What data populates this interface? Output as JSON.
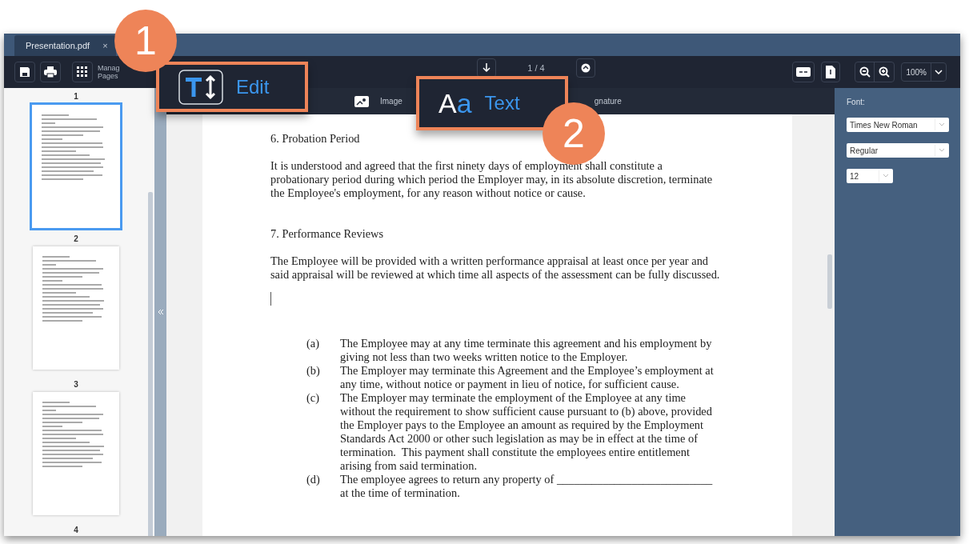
{
  "tab": {
    "title": "Presentation.pdf",
    "close": "×"
  },
  "toolbar": {
    "manage_pages": [
      "Manag",
      "Pages"
    ],
    "page_indicator": "1 / 4",
    "zoom": "100%"
  },
  "edit_toolbar": [
    {
      "kind": "image",
      "label": "Image"
    },
    {
      "kind": "signature",
      "label": "gnature"
    }
  ],
  "thumbnails": [
    {
      "number": "1",
      "selected": true
    },
    {
      "number": "2",
      "selected": false
    },
    {
      "number": "3",
      "selected": false
    }
  ],
  "next_page_number": "4",
  "document": [
    {
      "kind": "heading",
      "text": "6. Probation Period"
    },
    {
      "kind": "paragraph",
      "lines": [
        "It is understood and agreed that the first ninety days of employment shall constitute a",
        "probationary period during which period the Employer may, in its absolute discretion, terminate",
        "the Employee's employment, for any reason without notice or cause."
      ]
    },
    {
      "kind": "heading",
      "text": "7. Performance Reviews"
    },
    {
      "kind": "paragraph",
      "lines": [
        "The Employee will be provided with a written performance appraisal at least once per year and",
        "said appraisal will be reviewed at which time all aspects of the assessment can be fully discussed."
      ]
    },
    {
      "kind": "cursor"
    },
    {
      "kind": "list",
      "items": [
        {
          "label": "(a)",
          "lines": [
            "The Employee may at any time terminate this agreement and his employment by",
            "giving not less than two weeks written notice to the Employer."
          ]
        },
        {
          "label": "(b)",
          "lines": [
            "The Employer may terminate this Agreement and the Employee’s employment at",
            "any time, without notice or payment in lieu of notice, for sufficient cause."
          ]
        },
        {
          "label": "(c)",
          "lines": [
            "The Employer may terminate the employment of the Employee at any time",
            "without the requirement to show sufficient cause pursuant to (b) above, provided",
            "the Employer pays to the Employee an amount as required by the Employment",
            "Standards Act 2000 or other such legislation as may be in effect at the time of",
            "termination.  This payment shall constitute the employees entire entitlement",
            "arising from said termination."
          ]
        },
        {
          "label": "(d)",
          "lines": [
            "The employee agrees to return any property of ___________________________",
            "at the time of termination."
          ]
        }
      ]
    }
  ],
  "font_panel": {
    "label": "Font:",
    "family": "Times New Roman",
    "style": "Regular",
    "size": "12"
  },
  "callouts": [
    {
      "kind": "edit",
      "number": "1",
      "label": "Edit"
    },
    {
      "kind": "text",
      "number": "2",
      "label": "Text",
      "icon_text": "Aa"
    }
  ]
}
